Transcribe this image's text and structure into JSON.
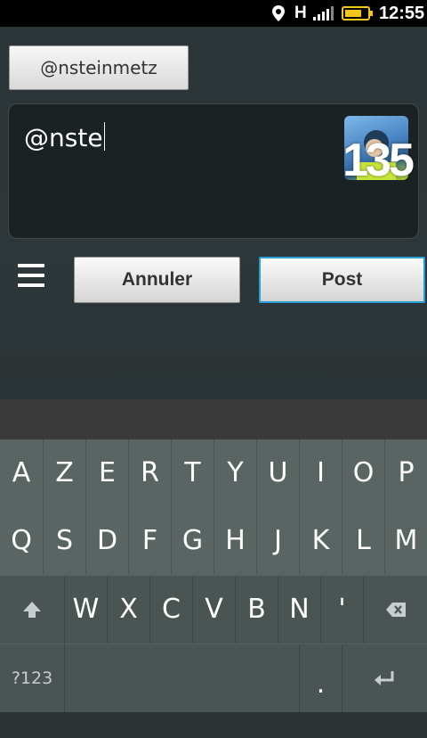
{
  "status_bar": {
    "network": "H",
    "time": "12:55",
    "icons": [
      "location-icon",
      "signal-icon",
      "battery-icon"
    ],
    "battery_color": "#f5c518"
  },
  "compose": {
    "mention_chip": "@nsteinmetz",
    "text": "@nste",
    "remaining_count": "135"
  },
  "actions": {
    "cancel_label": "Annuler",
    "post_label": "Post",
    "post_border_color": "#28a0d6"
  },
  "keyboard": {
    "row1": [
      "A",
      "Z",
      "E",
      "R",
      "T",
      "Y",
      "U",
      "I",
      "O",
      "P"
    ],
    "row2": [
      "Q",
      "S",
      "D",
      "F",
      "G",
      "H",
      "J",
      "K",
      "L",
      "M"
    ],
    "row3": [
      "W",
      "X",
      "C",
      "V",
      "B",
      "N",
      "'"
    ],
    "symbols_label": "?123",
    "period": "."
  }
}
